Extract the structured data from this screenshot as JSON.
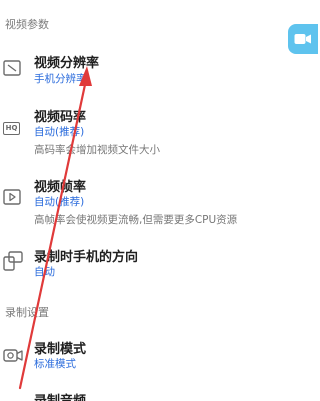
{
  "sections": {
    "video_params": "视频参数",
    "record_settings": "录制设置"
  },
  "items": {
    "resolution": {
      "title": "视频分辨率",
      "value": "手机分辨率"
    },
    "bitrate": {
      "title": "视频码率",
      "value": "自动(推荐)",
      "desc": "高码率会增加视频文件大小"
    },
    "framerate": {
      "title": "视频帧率",
      "value": "自动(推荐)",
      "desc": "高帧率会使视频更流畅,但需要更多CPU资源"
    },
    "orientation": {
      "title": "录制时手机的方向",
      "value": "自动"
    },
    "record_mode": {
      "title": "录制模式",
      "value": "标准模式"
    },
    "record_audio": {
      "title": "录制音频"
    }
  },
  "icons": {
    "hq_text": "HQ",
    "fab": "video-camera-icon",
    "annotation": "red-arrow"
  },
  "colors": {
    "accent": "#2a6bdc",
    "fab": "#5ec3ee",
    "arrow": "#e03a3a"
  }
}
